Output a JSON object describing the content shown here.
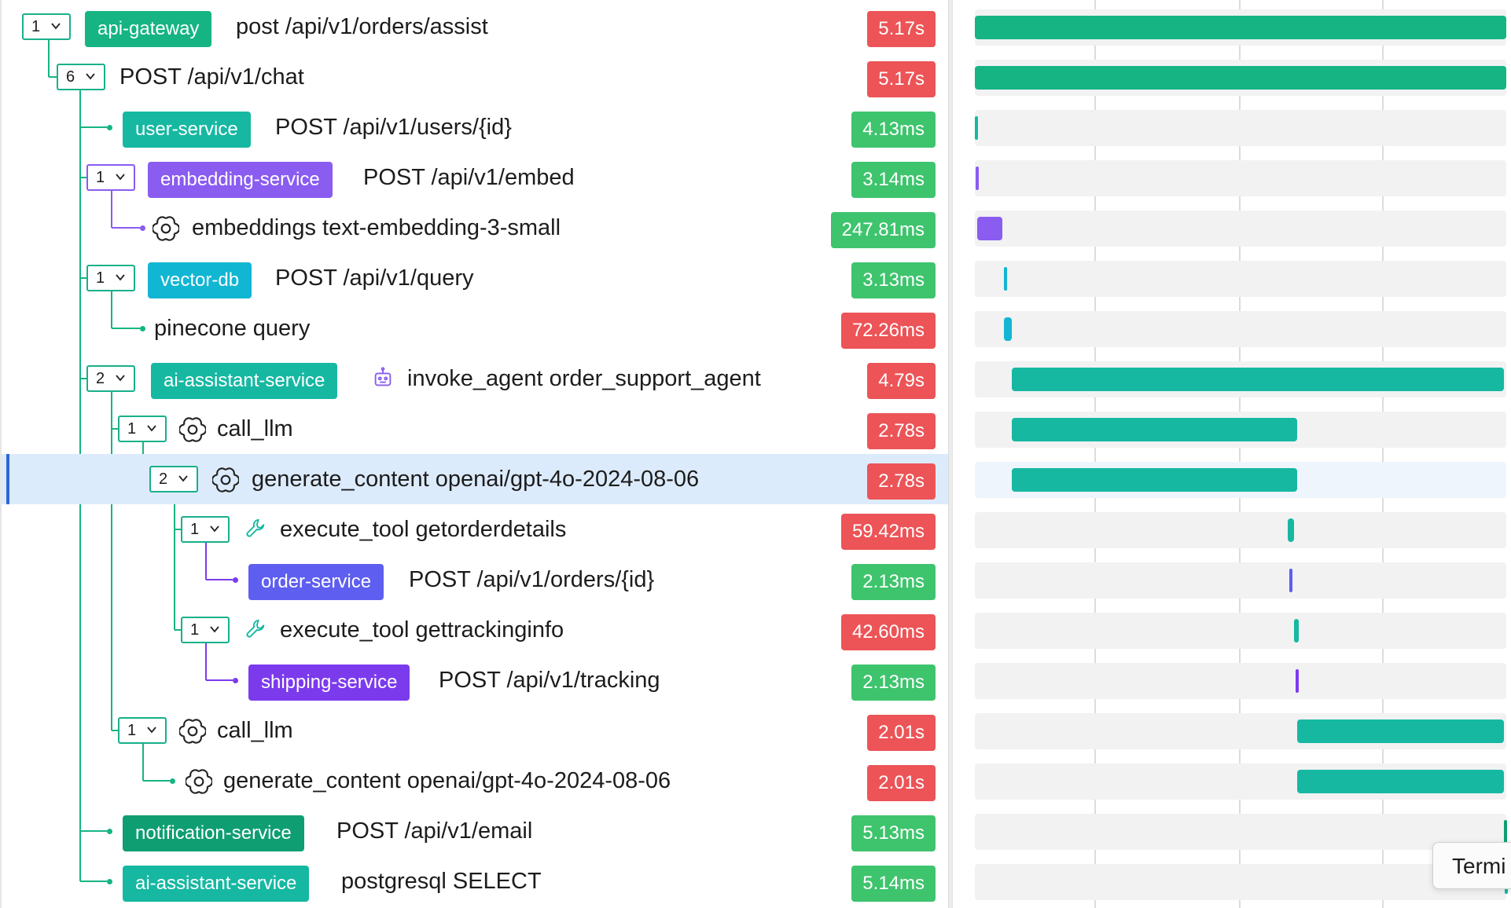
{
  "spans": [
    {
      "service": "api-gateway",
      "service_color": "#16b483",
      "label": "post /api/v1/orders/assist",
      "duration": "5.17s",
      "status": "slow",
      "icon": null,
      "counter": "1"
    },
    {
      "service": null,
      "label": "POST /api/v1/chat",
      "duration": "5.17s",
      "status": "slow",
      "icon": null,
      "counter": "6"
    },
    {
      "service": "user-service",
      "service_color": "#16b8a2",
      "label": "POST /api/v1/users/{id}",
      "duration": "4.13ms",
      "status": "ok",
      "icon": null,
      "counter": null
    },
    {
      "service": "embedding-service",
      "service_color": "#8a5cf0",
      "label": "POST /api/v1/embed",
      "duration": "3.14ms",
      "status": "ok",
      "icon": null,
      "counter": "1"
    },
    {
      "service": null,
      "label": "embeddings text-embedding-3-small",
      "duration": "247.81ms",
      "status": "ok",
      "icon": "openai-icon",
      "counter": null
    },
    {
      "service": "vector-db",
      "service_color": "#11b6d2",
      "label": "POST /api/v1/query",
      "duration": "3.13ms",
      "status": "ok",
      "icon": null,
      "counter": "1"
    },
    {
      "service": null,
      "label": "pinecone query",
      "duration": "72.26ms",
      "status": "slow",
      "icon": null,
      "counter": null
    },
    {
      "service": "ai-assistant-service",
      "service_color": "#16b8a2",
      "label": "invoke_agent order_support_agent",
      "duration": "4.79s",
      "status": "slow",
      "icon": "robot-icon",
      "counter": "2"
    },
    {
      "service": null,
      "label": "call_llm",
      "duration": "2.78s",
      "status": "slow",
      "icon": "openai-icon",
      "counter": "1"
    },
    {
      "service": null,
      "label": "generate_content openai/gpt-4o-2024-08-06",
      "duration": "2.78s",
      "status": "slow",
      "icon": "openai-icon",
      "counter": "2"
    },
    {
      "service": null,
      "label": "execute_tool getorderdetails",
      "duration": "59.42ms",
      "status": "slow",
      "icon": "wrench-icon",
      "counter": "1"
    },
    {
      "service": "order-service",
      "service_color": "#5e5ef0",
      "label": "POST /api/v1/orders/{id}",
      "duration": "2.13ms",
      "status": "ok",
      "icon": null,
      "counter": null
    },
    {
      "service": null,
      "label": "execute_tool gettrackinginfo",
      "duration": "42.60ms",
      "status": "slow",
      "icon": "wrench-icon",
      "counter": "1"
    },
    {
      "service": "shipping-service",
      "service_color": "#7c3aed",
      "label": "POST /api/v1/tracking",
      "duration": "2.13ms",
      "status": "ok",
      "icon": null,
      "counter": null
    },
    {
      "service": null,
      "label": "call_llm",
      "duration": "2.01s",
      "status": "slow",
      "icon": "openai-icon",
      "counter": "1"
    },
    {
      "service": null,
      "label": "generate_content openai/gpt-4o-2024-08-06",
      "duration": "2.01s",
      "status": "slow",
      "icon": "openai-icon",
      "counter": null
    },
    {
      "service": "notification-service",
      "service_color": "#0f9e72",
      "label": "POST /api/v1/email",
      "duration": "5.13ms",
      "status": "ok",
      "icon": null,
      "counter": null
    },
    {
      "service": "ai-assistant-service",
      "service_color": "#16b8a2",
      "label": "postgresql SELECT",
      "duration": "5.14ms",
      "status": "ok",
      "icon": null,
      "counter": null
    }
  ],
  "timeline_bars": [
    {
      "start": 0.0,
      "end": 1.0,
      "color": "#16b483"
    },
    {
      "start": 0.0,
      "end": 1.0,
      "color": "#16b483"
    },
    {
      "start": 0.0,
      "end": 0.004,
      "color": "#16b8a2"
    },
    {
      "start": 0.002,
      "end": 0.006,
      "color": "#8a5cf0"
    },
    {
      "start": 0.004,
      "end": 0.052,
      "color": "#8a5cf0"
    },
    {
      "start": 0.055,
      "end": 0.059,
      "color": "#11b6d2"
    },
    {
      "start": 0.055,
      "end": 0.07,
      "color": "#11b6d2"
    },
    {
      "start": 0.069,
      "end": 0.995,
      "color": "#16b8a2"
    },
    {
      "start": 0.069,
      "end": 0.606,
      "color": "#16b8a2"
    },
    {
      "start": 0.069,
      "end": 0.606,
      "color": "#16b8a2"
    },
    {
      "start": 0.589,
      "end": 0.601,
      "color": "#16b8a2"
    },
    {
      "start": 0.591,
      "end": 0.595,
      "color": "#5e5ef0"
    },
    {
      "start": 0.601,
      "end": 0.61,
      "color": "#16b8a2"
    },
    {
      "start": 0.603,
      "end": 0.607,
      "color": "#7c3aed"
    },
    {
      "start": 0.606,
      "end": 0.995,
      "color": "#16b8a2"
    },
    {
      "start": 0.606,
      "end": 0.995,
      "color": "#16b8a2"
    },
    {
      "start": 0.996,
      "end": 1.0,
      "color": "#0f9e72"
    },
    {
      "start": 0.997,
      "end": 1.0,
      "color": "#16b8a2"
    }
  ],
  "status_colors": {
    "slow": "#ec5457",
    "ok": "#3ec46d"
  },
  "selected_index": 9,
  "tooltip": {
    "text": "Termi"
  }
}
